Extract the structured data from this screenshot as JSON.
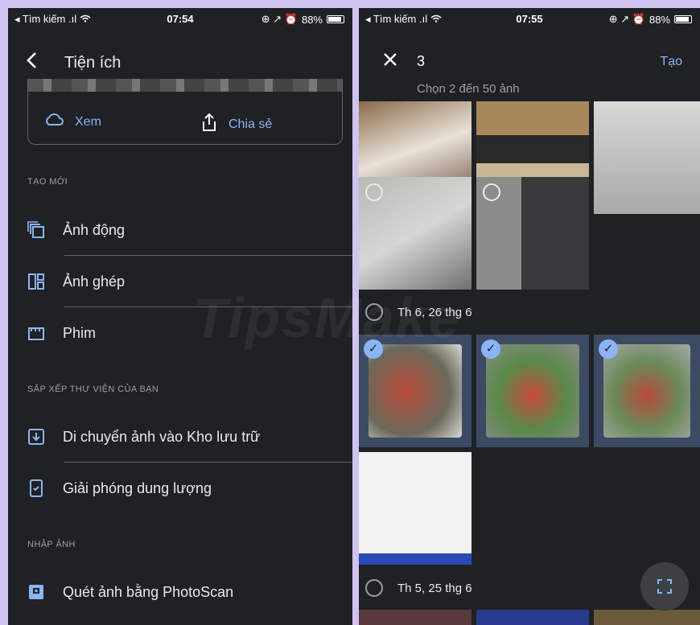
{
  "left": {
    "status": {
      "carrier": "◂ Tìm kiếm",
      "signal": ".ıl",
      "time": "07:54",
      "battery": "88%",
      "icons": "⊕ ↗ ⏰"
    },
    "title": "Tiện ích",
    "card": {
      "view_label": "Xem",
      "share_label": "Chia sẻ"
    },
    "sections": [
      {
        "header": "TẠO MỚI",
        "items": [
          "Ảnh động",
          "Ảnh ghép",
          "Phim"
        ]
      },
      {
        "header": "SẮP XẾP THƯ VIỆN CỦA BẠN",
        "items": [
          "Di chuyển ảnh vào Kho lưu trữ",
          "Giải phóng dung lượng"
        ]
      },
      {
        "header": "NHẬP ẢNH",
        "items": [
          "Quét ảnh bằng PhotoScan"
        ]
      }
    ],
    "watermark": "TipsMake"
  },
  "right": {
    "status": {
      "carrier": "◂ Tìm kiếm",
      "signal": ".ıl",
      "time": "07:55",
      "battery": "88%",
      "icons": "⊕ ↗ ⏰"
    },
    "selected_count": "3",
    "create_label": "Tạo",
    "hint": "Chọn 2 đến 50 ảnh",
    "dates": [
      "Th 6, 26 thg 6",
      "Th 5, 25 thg 6"
    ]
  },
  "colors": {
    "accent": "#8ab4f8",
    "background": "#202124"
  }
}
